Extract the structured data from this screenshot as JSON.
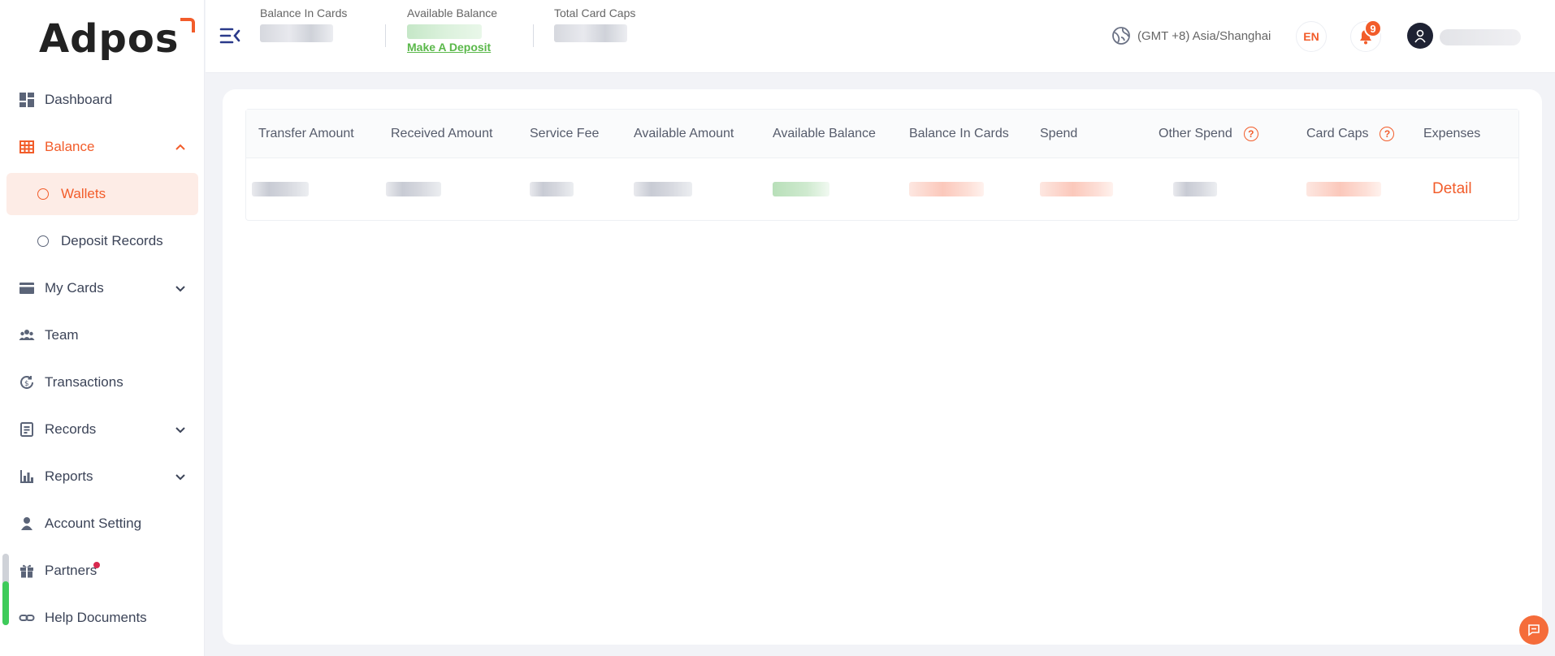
{
  "app": {
    "logo_text": "Adpos"
  },
  "sidebar": {
    "items": [
      {
        "label": "Dashboard",
        "icon": "dashboard-icon"
      },
      {
        "label": "Balance",
        "icon": "table-grid-icon",
        "active": true,
        "expanded": true,
        "children": [
          {
            "label": "Wallets",
            "selected": true
          },
          {
            "label": "Deposit Records"
          }
        ]
      },
      {
        "label": "My Cards",
        "icon": "card-icon",
        "has_children": true
      },
      {
        "label": "Team",
        "icon": "team-icon"
      },
      {
        "label": "Transactions",
        "icon": "exchange-icon"
      },
      {
        "label": "Records",
        "icon": "records-icon",
        "has_children": true
      },
      {
        "label": "Reports",
        "icon": "bar-chart-icon",
        "has_children": true
      },
      {
        "label": "Account Setting",
        "icon": "user-icon"
      },
      {
        "label": "Partners",
        "icon": "gift-icon",
        "notification_dot": true
      },
      {
        "label": "Help Documents",
        "icon": "link-icon"
      }
    ]
  },
  "header": {
    "stats": [
      {
        "label": "Balance In Cards",
        "value": ""
      },
      {
        "label": "Available Balance",
        "value": "",
        "action": "Make A Deposit"
      },
      {
        "label": "Total Card Caps",
        "value": ""
      }
    ],
    "timezone": "(GMT +8) Asia/Shanghai",
    "language": "EN",
    "notification_count": "9",
    "username": ""
  },
  "table": {
    "columns": [
      "Transfer Amount",
      "Received Amount",
      "Service Fee",
      "Available Amount",
      "Available Balance",
      "Balance In Cards",
      "Spend",
      "Other Spend",
      "Card Caps",
      "Expenses"
    ],
    "help_columns": [
      "Other Spend",
      "Card Caps"
    ],
    "rows": [
      {
        "values": [
          "",
          "",
          "",
          "",
          "",
          "",
          "",
          "",
          "",
          ""
        ],
        "action": "Detail"
      }
    ]
  },
  "colors": {
    "accent": "#f25c2a",
    "deposit_link": "#5ab84a",
    "active_bg": "#fdece6"
  }
}
